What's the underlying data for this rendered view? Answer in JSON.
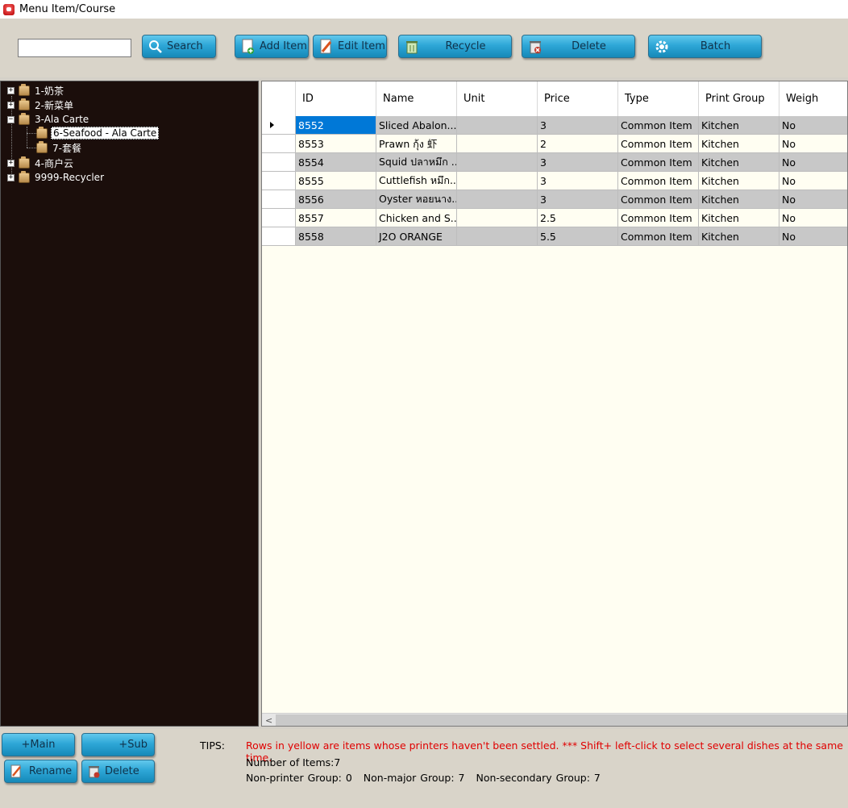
{
  "window": {
    "title": "Menu Item/Course"
  },
  "toolbar": {
    "search_value": "",
    "search_label": "Search",
    "add_label": "Add Item",
    "edit_label": "Edit Item",
    "recycle_label": "Recycle",
    "delete_label": "Delete",
    "batch_label": "Batch"
  },
  "tree": {
    "nodes": [
      {
        "label": "1-奶茶",
        "expander": "+"
      },
      {
        "label": "2-新菜单",
        "expander": "+"
      },
      {
        "label": "3-Ala Carte",
        "expander": "−"
      },
      {
        "label": "6-Seafood - Ala Carte",
        "selected": true
      },
      {
        "label": "7-套餐"
      },
      {
        "label": "4-商户云",
        "expander": "+"
      },
      {
        "label": "9999-Recycler",
        "expander": "+"
      }
    ]
  },
  "grid": {
    "columns": [
      "ID",
      "Name",
      "Unit",
      "Price",
      "Type",
      "Print Group",
      "Weigh"
    ],
    "rows": [
      [
        "8552",
        "Sliced Abalon...",
        "",
        "3",
        "Common Item",
        "Kitchen",
        "No"
      ],
      [
        "8553",
        "Prawn กุ้ง 虾",
        "",
        "2",
        "Common Item",
        "Kitchen",
        "No"
      ],
      [
        "8554",
        "Squid ปลาหมึก ...",
        "",
        "3",
        "Common Item",
        "Kitchen",
        "No"
      ],
      [
        "8555",
        "Cuttlefish หมึก...",
        "",
        "3",
        "Common Item",
        "Kitchen",
        "No"
      ],
      [
        "8556",
        "Oyster หอยนาง...",
        "",
        "3",
        "Common Item",
        "Kitchen",
        "No"
      ],
      [
        "8557",
        "Chicken and S...",
        "",
        "2.5",
        "Common Item",
        "Kitchen",
        "No"
      ],
      [
        "8558",
        "J2O ORANGE",
        "",
        "5.5",
        "Common Item",
        "Kitchen",
        "No"
      ]
    ]
  },
  "bottom": {
    "main_label": "+Main",
    "sub_label": "+Sub",
    "rename_label": "Rename",
    "delete_label": "Delete",
    "tips_label": "TIPS:",
    "tips_text": "Rows in yellow are items whose printers haven't been settled. *** Shift+ left-click to select several dishes at the same time.",
    "item_count": "Number of Items:7",
    "non_printer": "Non-printer Group: 0",
    "non_major": "Non-major Group: 7",
    "non_secondary": "Non-secondary Group: 7"
  },
  "colors": {
    "button_blue": "#2ea7d7",
    "tree_bg": "#1b0e0b",
    "selection_blue": "#0078d7",
    "tips_red": "#e00000"
  }
}
